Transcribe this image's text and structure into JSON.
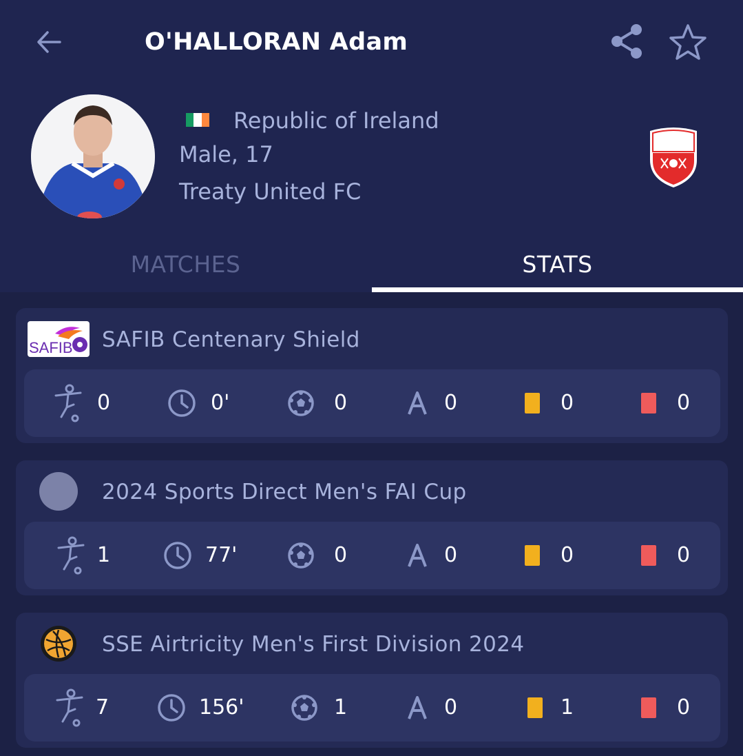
{
  "header": {
    "title": "O'HALLORAN Adam",
    "back_icon": "arrow-left-icon",
    "share_icon": "share-icon",
    "favorite_icon": "star-outline-icon"
  },
  "player": {
    "country": "Republic of Ireland",
    "gender_age": "Male, 17",
    "team": "Treaty United FC",
    "flag_colors": [
      "#169b62",
      "#ffffff",
      "#ff883e"
    ]
  },
  "tabs": [
    {
      "label": "MATCHES",
      "active": false
    },
    {
      "label": "STATS",
      "active": true
    }
  ],
  "competitions": [
    {
      "name": "SAFIB Centenary Shield",
      "logo": "safib-logo",
      "stats": {
        "appearances": "0",
        "minutes": "0'",
        "goals": "0",
        "assists": "0",
        "yellow_cards": "0",
        "red_cards": "0"
      }
    },
    {
      "name": "2024 Sports Direct Men's FAI Cup",
      "logo": "placeholder-circle",
      "stats": {
        "appearances": "1",
        "minutes": "77'",
        "goals": "0",
        "assists": "0",
        "yellow_cards": "0",
        "red_cards": "0"
      }
    },
    {
      "name": "SSE Airtricity Men's First Division 2024",
      "logo": "football-ball-logo",
      "stats": {
        "appearances": "7",
        "minutes": "156'",
        "goals": "1",
        "assists": "0",
        "yellow_cards": "1",
        "red_cards": "0"
      }
    }
  ],
  "colors": {
    "background": "#1c2145",
    "header_bg": "#1f2550",
    "card_bg": "#242a55",
    "stat_row_bg": "#2d3463",
    "icon": "#8c98c8",
    "yellow_card": "#f2b01e",
    "red_card": "#ef5b5b"
  }
}
